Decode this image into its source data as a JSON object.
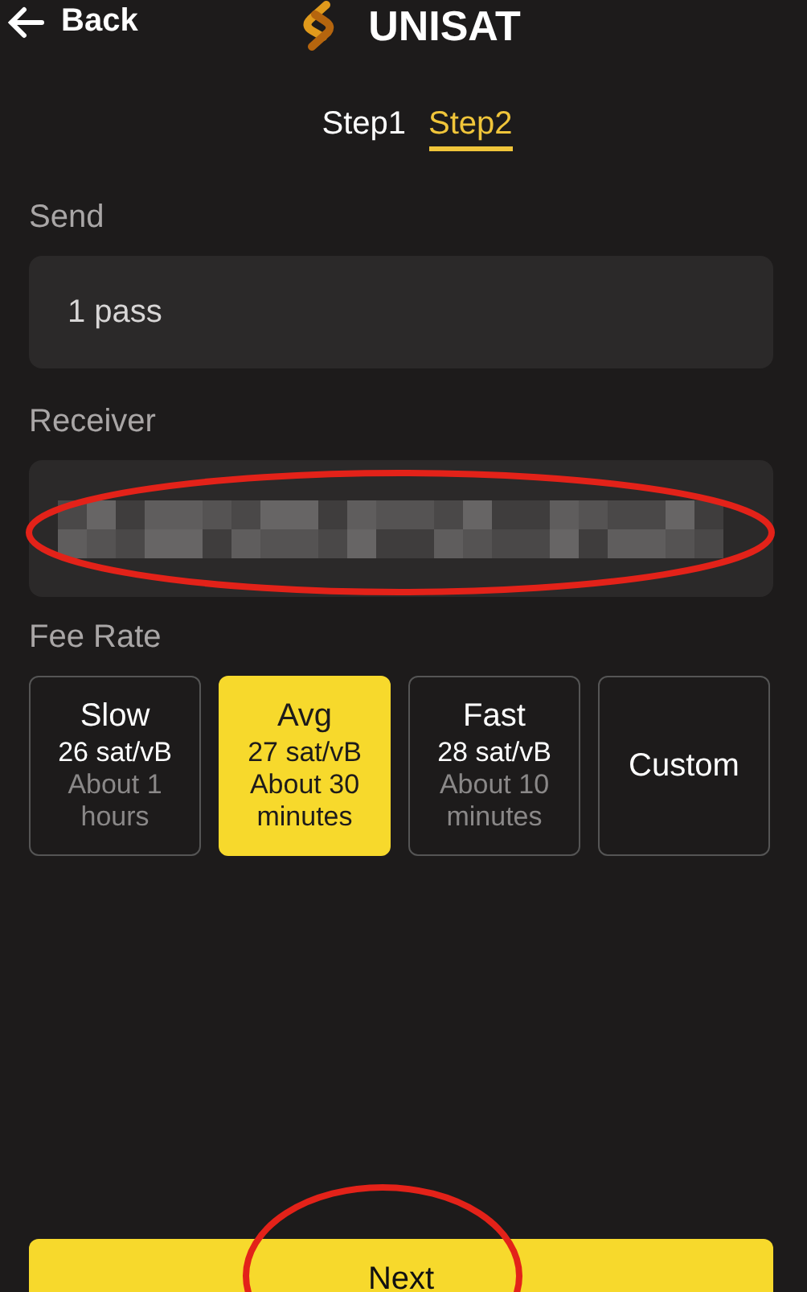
{
  "header": {
    "back": "Back",
    "title": "UNISAT"
  },
  "steps": [
    {
      "label": "Step1",
      "selected": false
    },
    {
      "label": "Step2",
      "selected": true
    }
  ],
  "send": {
    "label": "Send",
    "value": "1 pass"
  },
  "receiver": {
    "label": "Receiver",
    "redacted": true,
    "circled": true
  },
  "fee_rate": {
    "label": "Fee Rate",
    "options": [
      {
        "name": "Slow",
        "rate": "26 sat/vB",
        "time": "About 1 hours",
        "selected": false
      },
      {
        "name": "Avg",
        "rate": "27 sat/vB",
        "time": "About 30 minutes",
        "selected": true
      },
      {
        "name": "Fast",
        "rate": "28 sat/vB",
        "time": "About 10 minutes",
        "selected": false
      },
      {
        "name": "Custom",
        "selected": false
      }
    ]
  },
  "next_button": {
    "label": "Next",
    "circled": true
  }
}
